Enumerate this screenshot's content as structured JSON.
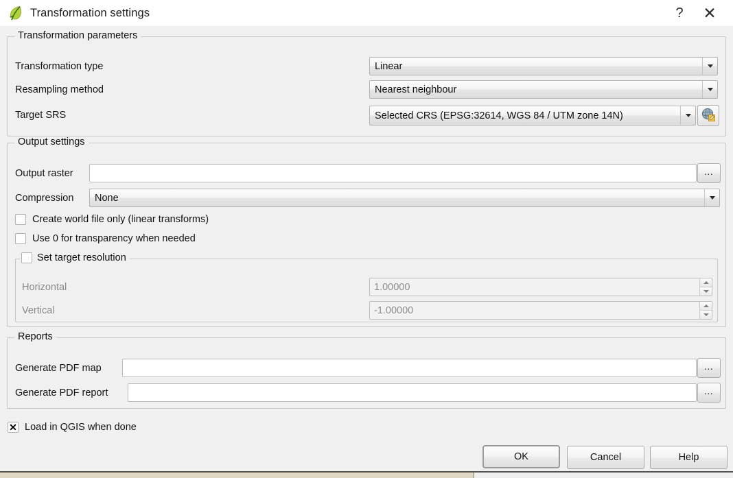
{
  "window": {
    "title": "Transformation settings",
    "app_icon": "qgis-leaf-icon",
    "help_button": "?",
    "close_button": "✕"
  },
  "transformation_parameters": {
    "group_title": "Transformation parameters",
    "transformation_type": {
      "label": "Transformation type",
      "value": "Linear"
    },
    "resampling_method": {
      "label": "Resampling method",
      "value": "Nearest neighbour"
    },
    "target_srs": {
      "label": "Target SRS",
      "value": "Selected CRS (EPSG:32614, WGS 84 / UTM zone 14N)",
      "select_button_icon": "globe-crs-icon"
    }
  },
  "output_settings": {
    "group_title": "Output settings",
    "output_raster": {
      "label": "Output raster",
      "value": "",
      "browse_label": "…"
    },
    "compression": {
      "label": "Compression",
      "value": "None"
    },
    "create_world_file": {
      "label": "Create world file only (linear transforms)",
      "checked": false,
      "mark": ""
    },
    "use_zero_transparency": {
      "label": "Use 0 for transparency when needed",
      "checked": false,
      "mark": ""
    },
    "set_target_resolution": {
      "label": "Set target resolution",
      "checked": false,
      "mark": "",
      "horizontal": {
        "label": "Horizontal",
        "value": "1.00000"
      },
      "vertical": {
        "label": "Vertical",
        "value": "-1.00000"
      }
    }
  },
  "reports": {
    "group_title": "Reports",
    "pdf_map": {
      "label": "Generate PDF map",
      "value": "",
      "browse_label": "…"
    },
    "pdf_report": {
      "label": "Generate PDF report",
      "value": "",
      "browse_label": "…"
    }
  },
  "load_in_qgis": {
    "label": "Load in QGIS when done",
    "checked": true,
    "mark": "✕"
  },
  "buttons": {
    "ok": "OK",
    "cancel": "Cancel",
    "help": "Help"
  },
  "colors": {
    "dialog_background": "#f0f0f0",
    "titlebar_background": "#ffffff",
    "group_border": "#c8c8c8",
    "text": "#111111",
    "disabled_text": "#8a8a8a",
    "input_background": "#ffffff"
  }
}
